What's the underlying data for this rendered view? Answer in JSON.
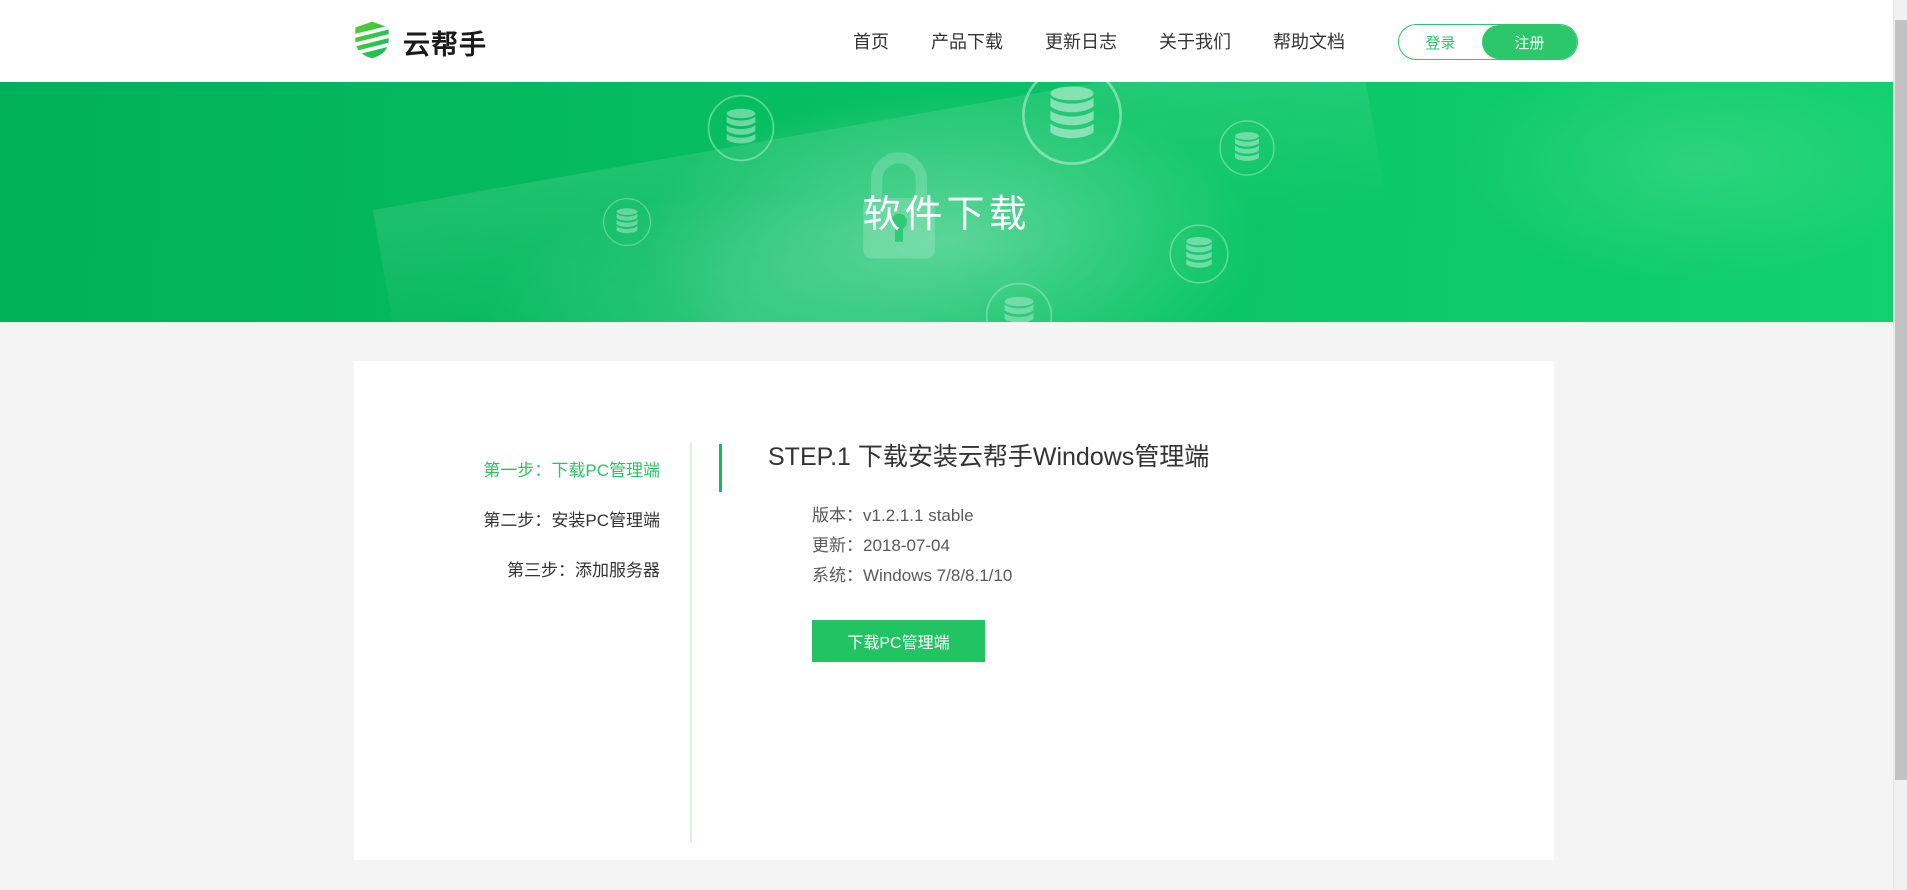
{
  "brand": {
    "name": "云帮手"
  },
  "nav": {
    "items": [
      {
        "label": "首页"
      },
      {
        "label": "产品下载"
      },
      {
        "label": "更新日志"
      },
      {
        "label": "关于我们"
      },
      {
        "label": "帮助文档"
      }
    ]
  },
  "auth": {
    "login_label": "登录",
    "register_label": "注册"
  },
  "hero": {
    "title": "软件下载"
  },
  "steps": {
    "items": [
      {
        "label": "第一步：下载PC管理端",
        "active": true
      },
      {
        "label": "第二步：安装PC管理端",
        "active": false
      },
      {
        "label": "第三步：添加服务器",
        "active": false
      }
    ]
  },
  "content": {
    "heading": "STEP.1 下载安装云帮手Windows管理端",
    "details": [
      {
        "text": "版本：v1.2.1.1 stable"
      },
      {
        "text": "更新：2018-07-04"
      },
      {
        "text": "系统：Windows 7/8/8.1/10"
      }
    ],
    "download_button_label": "下载PC管理端"
  },
  "colors": {
    "brand_green": "#22c362",
    "auth_green": "#2cc76a",
    "active_step_green": "#2cc364",
    "hero_gradient_start": "#00b159",
    "hero_gradient_end": "#12d16e",
    "divider_light_green": "#d9efe2",
    "page_background": "#f4f4f4",
    "scrollbar_thumb": "#c2c2c2"
  }
}
